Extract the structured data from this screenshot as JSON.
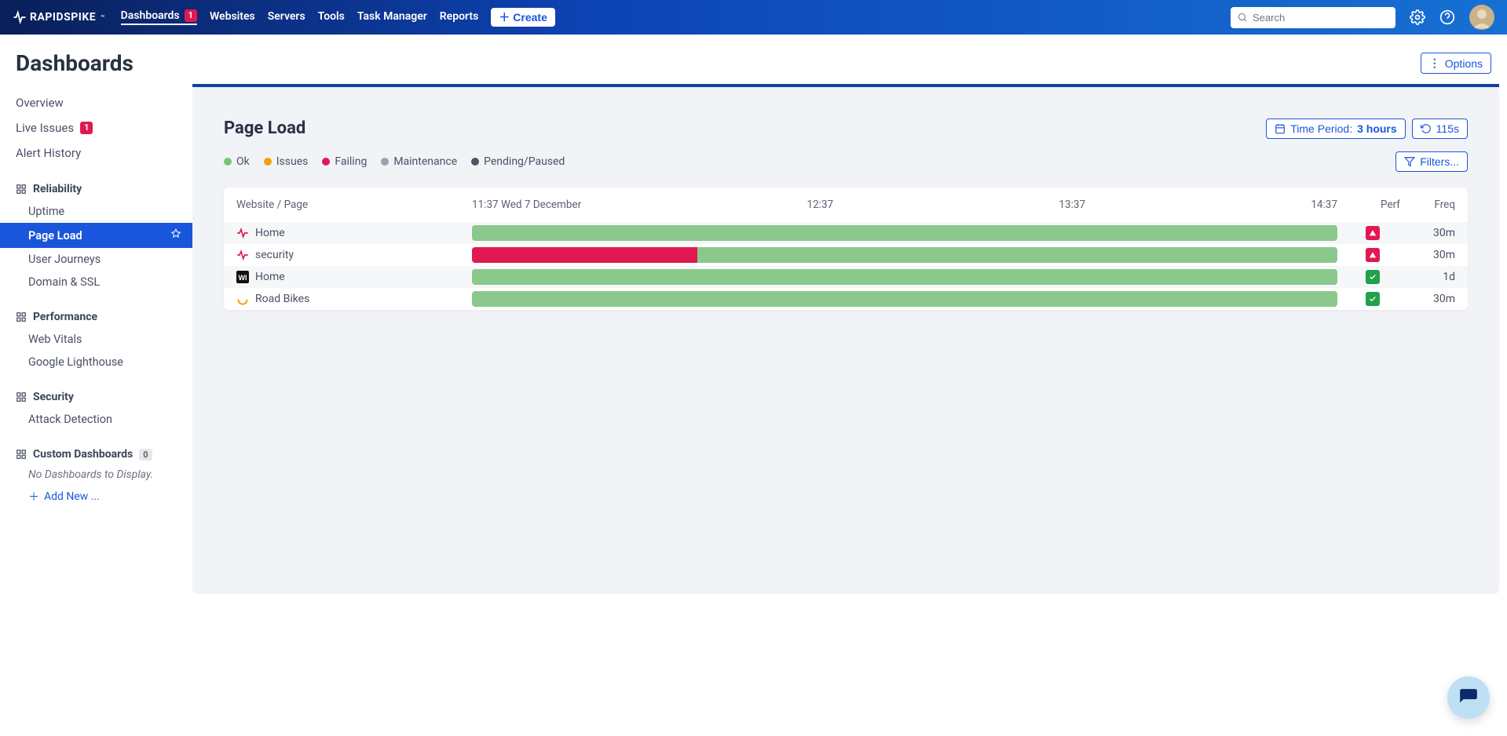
{
  "brand": {
    "name": "RAPIDSPIKE"
  },
  "nav": {
    "items": [
      {
        "label": "Dashboards",
        "badge": "1",
        "active": true
      },
      {
        "label": "Websites"
      },
      {
        "label": "Servers"
      },
      {
        "label": "Tools"
      },
      {
        "label": "Task Manager"
      },
      {
        "label": "Reports"
      }
    ],
    "create": "Create",
    "search_placeholder": "Search"
  },
  "page": {
    "title": "Dashboards",
    "options_label": "Options"
  },
  "sidebar": {
    "overview": "Overview",
    "live_issues": {
      "label": "Live Issues",
      "badge": "1"
    },
    "alert_history": "Alert History",
    "sections": {
      "reliability": {
        "label": "Reliability",
        "items": [
          "Uptime",
          "Page Load",
          "User Journeys",
          "Domain & SSL"
        ],
        "active": "Page Load"
      },
      "performance": {
        "label": "Performance",
        "items": [
          "Web Vitals",
          "Google Lighthouse"
        ]
      },
      "security": {
        "label": "Security",
        "items": [
          "Attack Detection"
        ]
      },
      "custom": {
        "label": "Custom Dashboards",
        "badge": "0",
        "empty": "No Dashboards to Display.",
        "add": "Add New ..."
      }
    }
  },
  "panel": {
    "title": "Page Load",
    "time_period": {
      "prefix": "Time Period: ",
      "value": "3 hours"
    },
    "refresh": "115s",
    "filters": "Filters...",
    "legend": [
      {
        "label": "Ok",
        "color": "ok"
      },
      {
        "label": "Issues",
        "color": "issues"
      },
      {
        "label": "Failing",
        "color": "failing"
      },
      {
        "label": "Maintenance",
        "color": "maint"
      },
      {
        "label": "Pending/Paused",
        "color": "pending"
      }
    ],
    "table": {
      "header": {
        "site": "Website / Page",
        "times": [
          "11:37 Wed 7 December",
          "12:37",
          "13:37",
          "14:37"
        ],
        "perf": "Perf",
        "freq": "Freq"
      },
      "rows": [
        {
          "name": "Home",
          "icon": "spike",
          "segments": [
            {
              "status": "ok",
              "pct": 100
            }
          ],
          "perf": "warn",
          "freq": "30m",
          "alt": true
        },
        {
          "name": "security",
          "icon": "spike",
          "segments": [
            {
              "status": "fail",
              "pct": 26
            },
            {
              "status": "ok",
              "pct": 74
            }
          ],
          "perf": "warn",
          "freq": "30m",
          "alt": false
        },
        {
          "name": "Home",
          "icon": "wi",
          "segments": [
            {
              "status": "ok",
              "pct": 100
            }
          ],
          "perf": "good",
          "freq": "1d",
          "alt": true
        },
        {
          "name": "Road Bikes",
          "icon": "orange",
          "segments": [
            {
              "status": "ok",
              "pct": 100
            }
          ],
          "perf": "good",
          "freq": "30m",
          "alt": false
        }
      ]
    }
  }
}
